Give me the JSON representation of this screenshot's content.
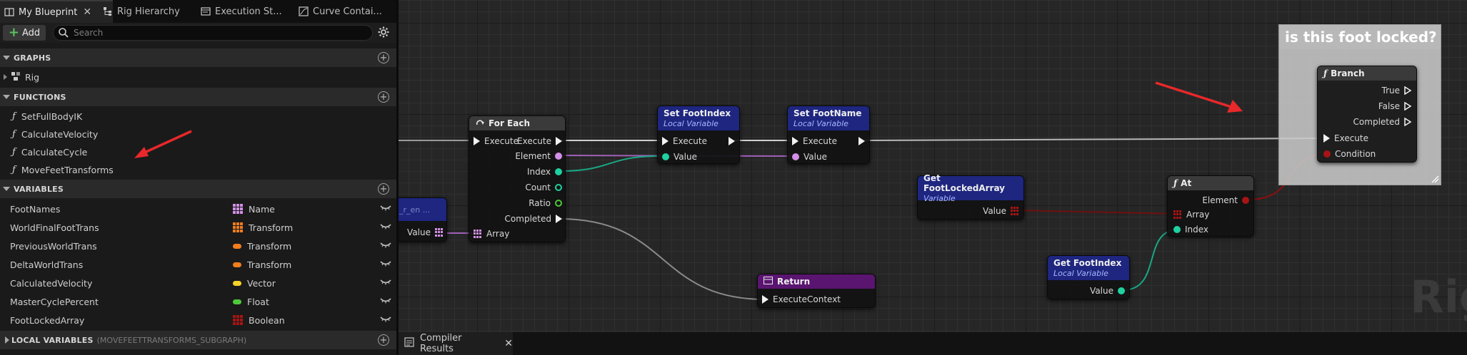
{
  "tabs": [
    {
      "label": "My Blueprint",
      "icon": "book-icon",
      "active": true
    },
    {
      "label": "Rig Hierarchy",
      "icon": "hierarchy-icon"
    },
    {
      "label": "Execution St...",
      "icon": "execution-stack-icon"
    },
    {
      "label": "Curve Contai...",
      "icon": "curve-icon"
    }
  ],
  "toolbar": {
    "add_label": "Add",
    "search_placeholder": "Search"
  },
  "sections": {
    "graphs": "GRAPHS",
    "functions": "FUNCTIONS",
    "variables": "VARIABLES",
    "local_variables": "LOCAL VARIABLES",
    "local_variables_sub": "(MOVEFEETTRANSFORMS_SUBGRAPH)"
  },
  "graphs": [
    {
      "label": "Rig"
    }
  ],
  "functions": [
    {
      "label": "SetFullBodyIK"
    },
    {
      "label": "CalculateVelocity"
    },
    {
      "label": "CalculateCycle"
    },
    {
      "label": "MoveFeetTransforms"
    }
  ],
  "variables": [
    {
      "name": "FootNames",
      "type": "Name",
      "color": "#d38fe6",
      "icon": "array"
    },
    {
      "name": "WorldFinalFootTrans",
      "type": "Transform",
      "color": "#f07d1e",
      "icon": "array"
    },
    {
      "name": "PreviousWorldTrans",
      "type": "Transform",
      "color": "#f07d1e",
      "icon": "pill"
    },
    {
      "name": "DeltaWorldTrans",
      "type": "Transform",
      "color": "#f07d1e",
      "icon": "pill"
    },
    {
      "name": "CalculatedVelocity",
      "type": "Vector",
      "color": "#f6d22a",
      "icon": "pill"
    },
    {
      "name": "MasterCyclePercent",
      "type": "Float",
      "color": "#4ec83b",
      "icon": "pill"
    },
    {
      "name": "FootLockedArray",
      "type": "Boolean",
      "color": "#a81414",
      "icon": "array"
    }
  ],
  "graph": {
    "partial_node": {
      "title": "_r_en ...",
      "value_label": "Value"
    },
    "for_each": {
      "title": "For Each",
      "pins_in": [
        "Execute",
        "Array"
      ],
      "pins_out": [
        "Execute",
        "Element",
        "Index",
        "Count",
        "Ratio",
        "Completed"
      ]
    },
    "set_foot_index": {
      "title": "Set FootIndex",
      "subtitle": "Local Variable",
      "pin_exec": "Execute",
      "pin_value": "Value"
    },
    "set_foot_name": {
      "title": "Set FootName",
      "subtitle": "Local Variable",
      "pin_exec": "Execute",
      "pin_value": "Value"
    },
    "get_foot_locked_array": {
      "title": "Get FootLockedArray",
      "subtitle": "Variable",
      "pin_value": "Value"
    },
    "at": {
      "title": "At",
      "pin_element": "Element",
      "pin_array": "Array",
      "pin_index": "Index"
    },
    "return": {
      "title": "Return",
      "pin_exec": "ExecuteContext"
    },
    "get_foot_index": {
      "title": "Get FootIndex",
      "subtitle": "Local Variable",
      "pin_value": "Value"
    },
    "branch": {
      "title": "Branch",
      "pins_out": [
        "True",
        "False",
        "Completed"
      ],
      "pins_in": [
        "Execute",
        "Condition"
      ]
    },
    "comment": "is this foot locked?",
    "watermark": "Rig"
  },
  "bottom": {
    "compiler_tab": "Compiler Results"
  },
  "colors": {
    "annotation": "#e8282a",
    "exec": "#f2f2f2",
    "name_pin": "#d38fe6",
    "int_pin": "#1fd1a0",
    "float_pin": "#4ec83b",
    "bool_pin": "#a81414",
    "node_header_var": "#1e2680",
    "node_header_return": "#5a1570"
  }
}
